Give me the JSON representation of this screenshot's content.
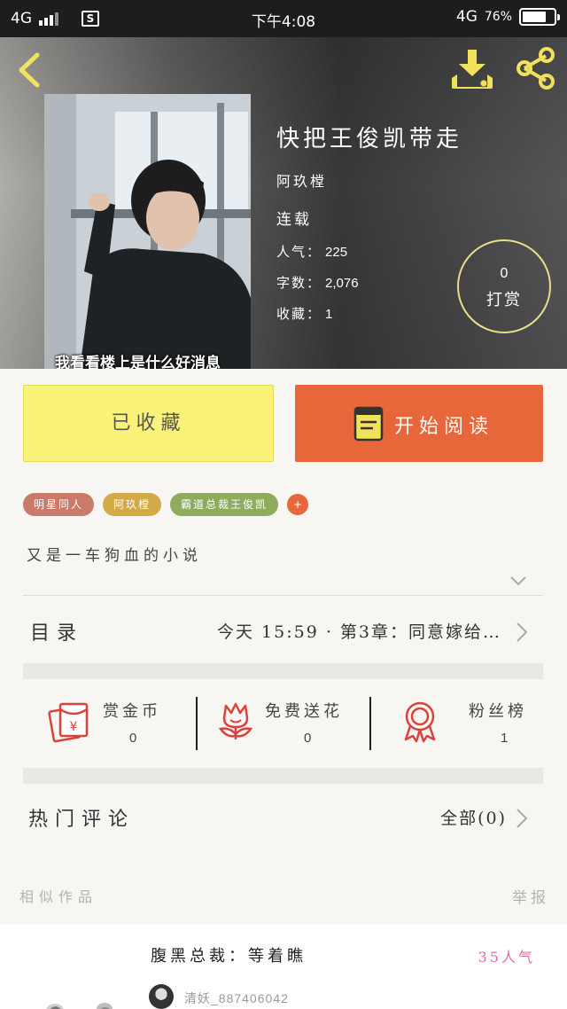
{
  "status_bar": {
    "network_left": "4G",
    "time": "下午4:08",
    "network_right": "4G",
    "battery": "76%",
    "battery_level": 0.76
  },
  "book": {
    "title": "快把王俊凯带走",
    "author": "阿玖樘",
    "status": "连载",
    "popularity_label": "人气：",
    "popularity": "225",
    "words_label": "字数：",
    "words": "2,076",
    "favorites_label": "收藏：",
    "favorites": "1",
    "cover_caption": "我看看楼上是什么好消息",
    "tip_count": "0",
    "tip_label": "打赏"
  },
  "actions": {
    "collected_label": "已收藏",
    "read_label": "开始阅读"
  },
  "tags": [
    {
      "label": "明星同人",
      "color": "#c97a69"
    },
    {
      "label": "阿玖樘",
      "color": "#d2ab48"
    },
    {
      "label": "霸道总裁王俊凯",
      "color": "#8fac5e"
    }
  ],
  "tag_add": "+",
  "description": "又是一车狗血的小说",
  "toc": {
    "label": "目录",
    "latest": "今天 15:59 · 第3章：同意嫁给…"
  },
  "stats": [
    {
      "label": "赏金币",
      "value": "0",
      "icon": "red-envelope-icon"
    },
    {
      "label": "免费送花",
      "value": "0",
      "icon": "flower-icon"
    },
    {
      "label": "粉丝榜",
      "value": "1",
      "icon": "medal-icon"
    }
  ],
  "comments": {
    "label": "热门评论",
    "all": "全部(0)"
  },
  "similar_label": "相似作品",
  "report_label": "举报",
  "related": {
    "title": "腹黑总裁：等着瞧",
    "popularity": "35人气",
    "user": "清妖_887406042"
  },
  "colors": {
    "accent_orange": "#e8673a",
    "collected_yellow": "#fbf27a",
    "icon_yellow": "#f2e25a",
    "icon_red": "#d9433b"
  }
}
